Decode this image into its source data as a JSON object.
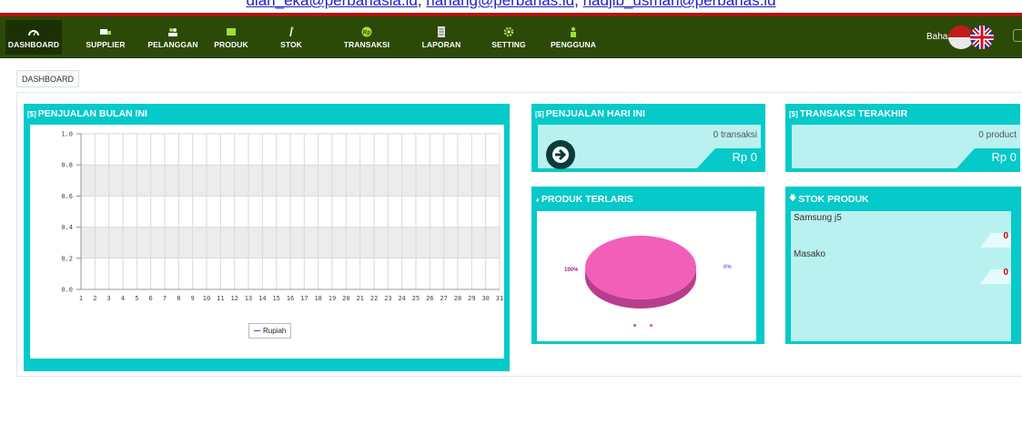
{
  "header_links": {
    "email1": "dian_eka@perbanasia.id",
    "email2": "nanang@perbanas.id",
    "email3": "hadjib_usman@perbanas.id",
    "separator": ","
  },
  "nav": {
    "items": [
      {
        "label": "DASHBOARD",
        "icon": "dashboard-icon",
        "active": true
      },
      {
        "label": "SUPPLIER",
        "icon": "truck-icon",
        "active": false
      },
      {
        "label": "PELANGGAN",
        "icon": "users-icon",
        "active": false
      },
      {
        "label": "PRODUK",
        "icon": "box-icon",
        "active": false
      },
      {
        "label": "STOK",
        "icon": "tools-icon",
        "active": false
      },
      {
        "label": "TRANSAKSI",
        "icon": "coin-icon",
        "active": false
      },
      {
        "label": "LAPORAN",
        "icon": "document-icon",
        "active": false
      },
      {
        "label": "SETTING",
        "icon": "gear-icon",
        "active": false
      },
      {
        "label": "PENGGUNA",
        "icon": "person-icon",
        "active": false
      }
    ],
    "language_label": "Bahasa"
  },
  "breadcrumb": {
    "current": "DASHBOARD"
  },
  "panels": {
    "sales_month": {
      "title": "PENJUALAN BULAN INI",
      "icon": "[$]"
    },
    "sales_today": {
      "title": "PENJUALAN HARI INI",
      "icon": "[$]",
      "count": "0 transaksi",
      "amount": "Rp 0"
    },
    "last_transaction": {
      "title": "TRANSAKSI TERAKHIR",
      "icon": "[$]",
      "count": "0 product",
      "amount": "Rp 0"
    },
    "best_products": {
      "title": "PRODUK TERLARIS"
    },
    "stock": {
      "title": "STOK PRODUK",
      "items": [
        {
          "name": "Samsung j5",
          "qty": "0"
        },
        {
          "name": "Masako",
          "qty": "0"
        }
      ]
    }
  },
  "chart_data": [
    {
      "type": "line",
      "x": [
        1,
        2,
        3,
        4,
        5,
        6,
        7,
        8,
        9,
        10,
        11,
        12,
        13,
        14,
        15,
        16,
        17,
        18,
        19,
        20,
        21,
        22,
        23,
        24,
        25,
        26,
        27,
        28,
        29,
        30,
        31
      ],
      "series": [
        {
          "name": "Rupiah",
          "values": []
        }
      ],
      "ylim": [
        0,
        1.0
      ],
      "yticks": [
        "0.0",
        "0.2",
        "0.4",
        "0.6",
        "0.8",
        "1.0"
      ],
      "grid": true,
      "legend": "bottom-center",
      "colors": {
        "series": "#3355cc"
      }
    },
    {
      "type": "pie",
      "labels": [
        "100%",
        "0%"
      ],
      "values": [
        100,
        0
      ],
      "colors": {
        "slice_main": "#f25fb8",
        "slice_small": "#7777dd",
        "legend_a": "#8888dd",
        "legend_b": "#ee66aa"
      }
    }
  ],
  "colors": {
    "nav_bg": "#2c4a07",
    "panel_accent": "#06c9c9",
    "panel_light": "#b9f1f1",
    "top_line": "#b31414"
  }
}
